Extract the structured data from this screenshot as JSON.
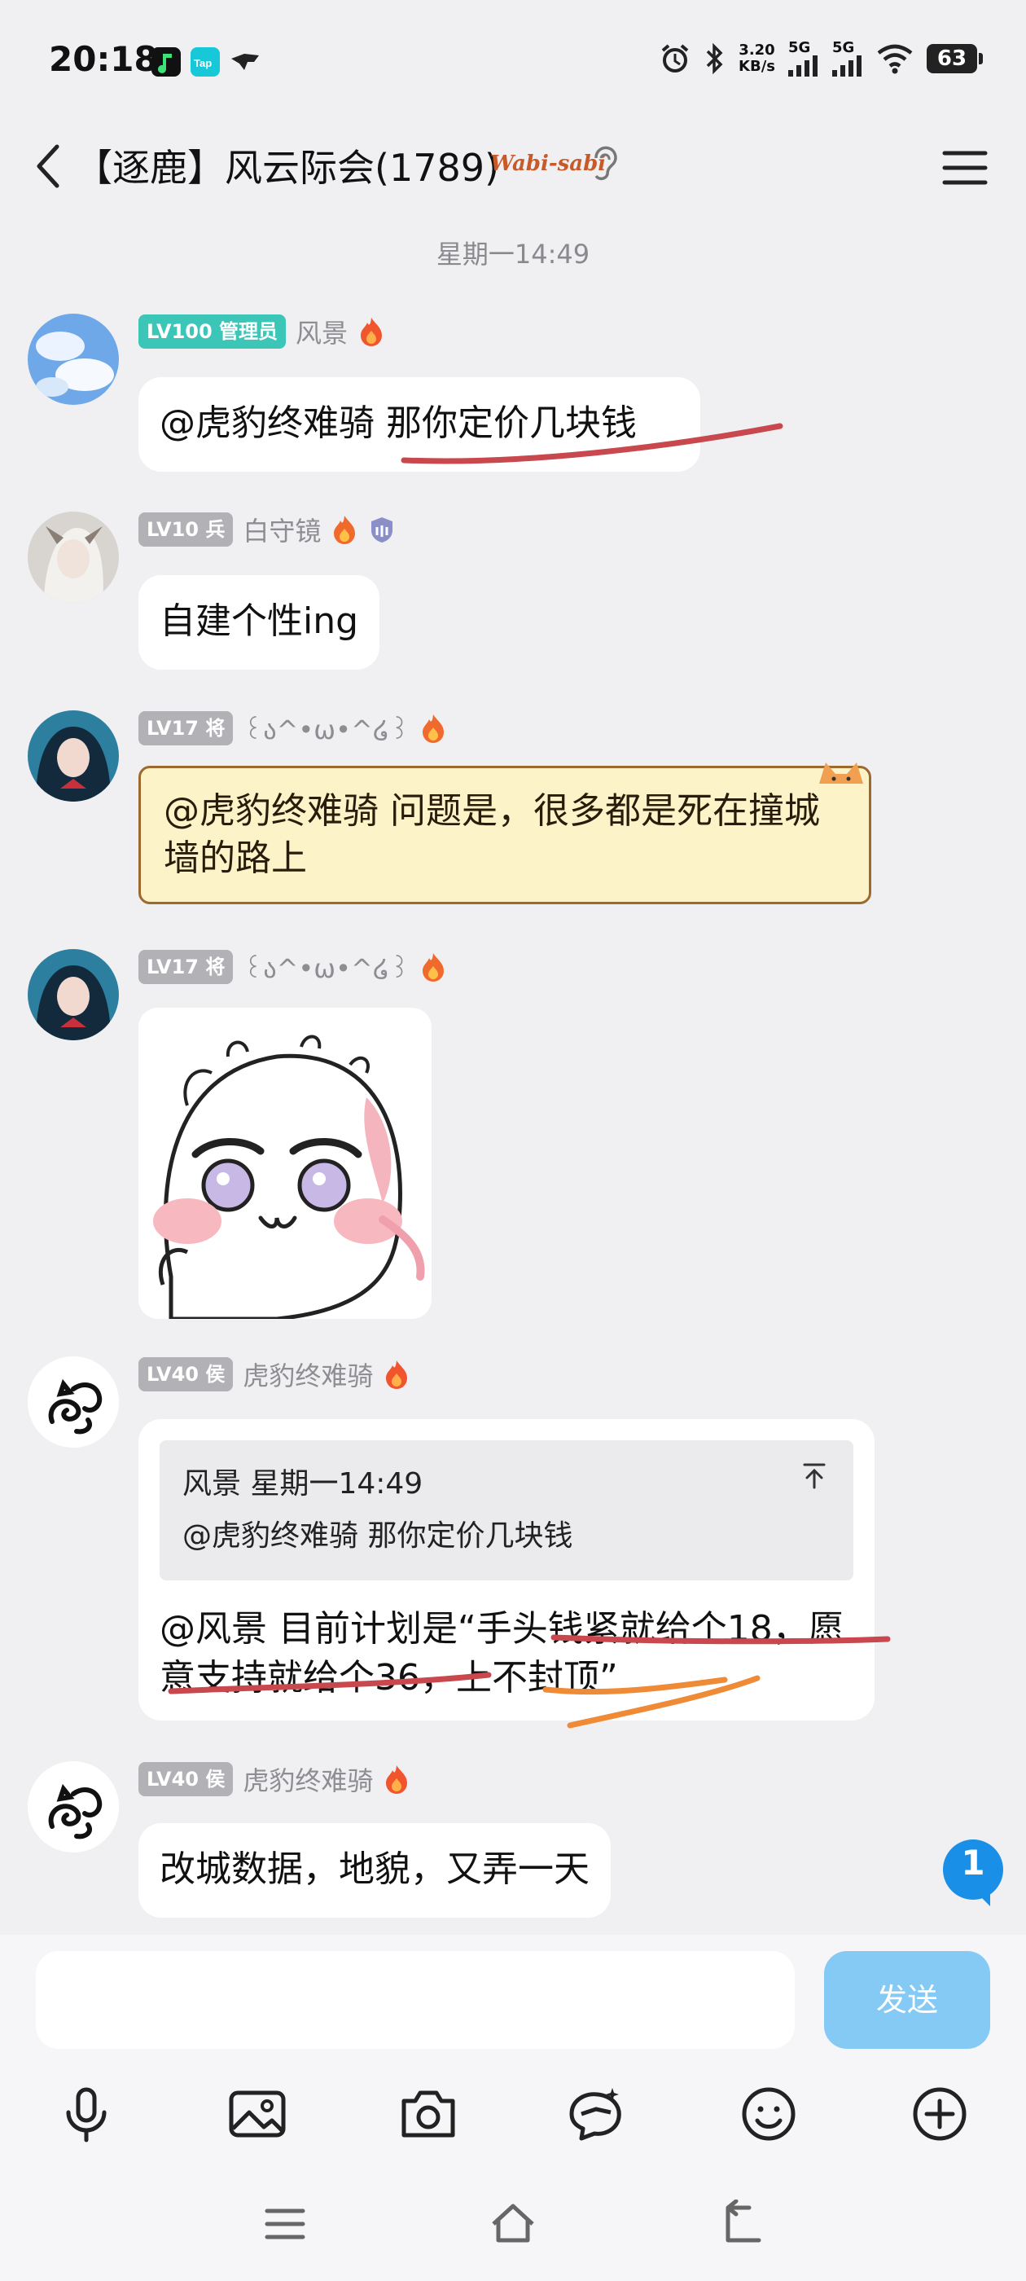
{
  "status_bar": {
    "time": "20:18",
    "speed_value": "3.20",
    "speed_unit": "KB/s",
    "sig1": "5G",
    "sig2": "5G",
    "battery": "63"
  },
  "header": {
    "title": "【逐鹿】风云际会(1789)",
    "badge_text": "Wabi-sabi"
  },
  "timestamp": "星期一14:49",
  "messages": [
    {
      "level": "LV100 管理员",
      "nick": "风景",
      "text": "@虎豹终难骑 那你定价几块钱"
    },
    {
      "level": "LV10 兵",
      "nick": "白守镜",
      "text": "自建个性ing"
    },
    {
      "level": "LV17 将",
      "nick": "꒰ა^•ω•^໒꒱",
      "text": "@虎豹终难骑 问题是，很多都是死在撞城墙的路上"
    },
    {
      "level": "LV17 将",
      "nick": "꒰ა^•ω•^໒꒱",
      "sticker": "bald-baby-sticker"
    },
    {
      "level": "LV40 侯",
      "nick": "虎豹终难骑",
      "quote": {
        "header": "风景 星期一14:49",
        "text": "@虎豹终难骑 那你定价几块钱"
      },
      "text": "@风景 目前计划是“手头钱紧就给个18，愿意支持就给个36，上不封顶”"
    },
    {
      "level": "LV40 侯",
      "nick": "虎豹终难骑",
      "text": "改城数据，地貌，又弄一天"
    }
  ],
  "unread_badge": "1",
  "input": {
    "placeholder": "",
    "send_label": "发送"
  },
  "toolbar": [
    "mic-icon",
    "image-icon",
    "camera-icon",
    "bubble-style-icon",
    "emoji-icon",
    "plus-icon"
  ],
  "colors": {
    "accent": "#84caf5",
    "admin_level": "#3cc6b8",
    "level_gray": "#b2b2b6",
    "badge": "#1a8fe8"
  }
}
